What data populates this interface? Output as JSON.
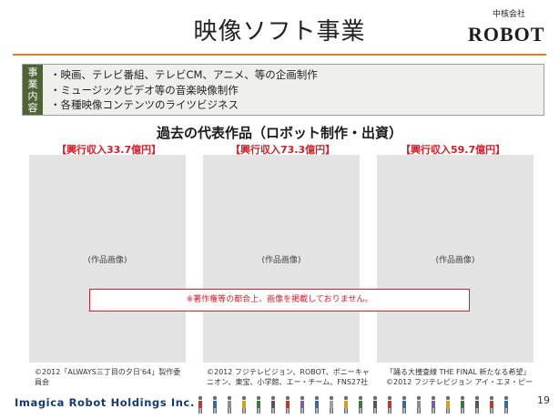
{
  "header": {
    "title": "映像ソフト事業",
    "logo_sub": "中核会社",
    "logo_main": "ROBOT"
  },
  "business": {
    "label_chars": [
      "事",
      "業",
      "内",
      "容"
    ],
    "items": [
      "映画、テレビ番組、テレビCM、アニメ、等の企画制作",
      "ミュージックビデオ等の音楽映像制作",
      "各種映像コンテンツのライツビジネス"
    ]
  },
  "works": {
    "heading": "過去の代表作品（ロボット制作・出資）",
    "items": [
      {
        "revenue": "【興行収入33.7億円】",
        "image_caption": "(作品画像)",
        "credit": "©2012「ALWAYS三丁目の夕日'64」製作委員会"
      },
      {
        "revenue": "【興行収入73.3億円】",
        "image_caption": "(作品画像)",
        "credit": "©2012 フジテレビジョン、ROBOT、ポニーキャニオン、東宝、小学館、エー・チーム、FNS27社"
      },
      {
        "revenue": "【興行収入59.7億円】",
        "image_caption": "(作品画像)",
        "credit": "「踊る大捜査線 THE FINAL 新たなる希望」©2012 フジテレビジョン アイ・エヌ・ピー"
      }
    ],
    "notice": "※著作権等の都合上、画像を掲載しておりません。"
  },
  "footer": {
    "company": "Imagica Robot Holdings Inc.",
    "page_number": "19"
  },
  "colors": {
    "title_rule": "#e67e22",
    "label_bg": "#4f6436",
    "revenue_red": "#d11f2a",
    "footer_blue": "#123a78"
  }
}
